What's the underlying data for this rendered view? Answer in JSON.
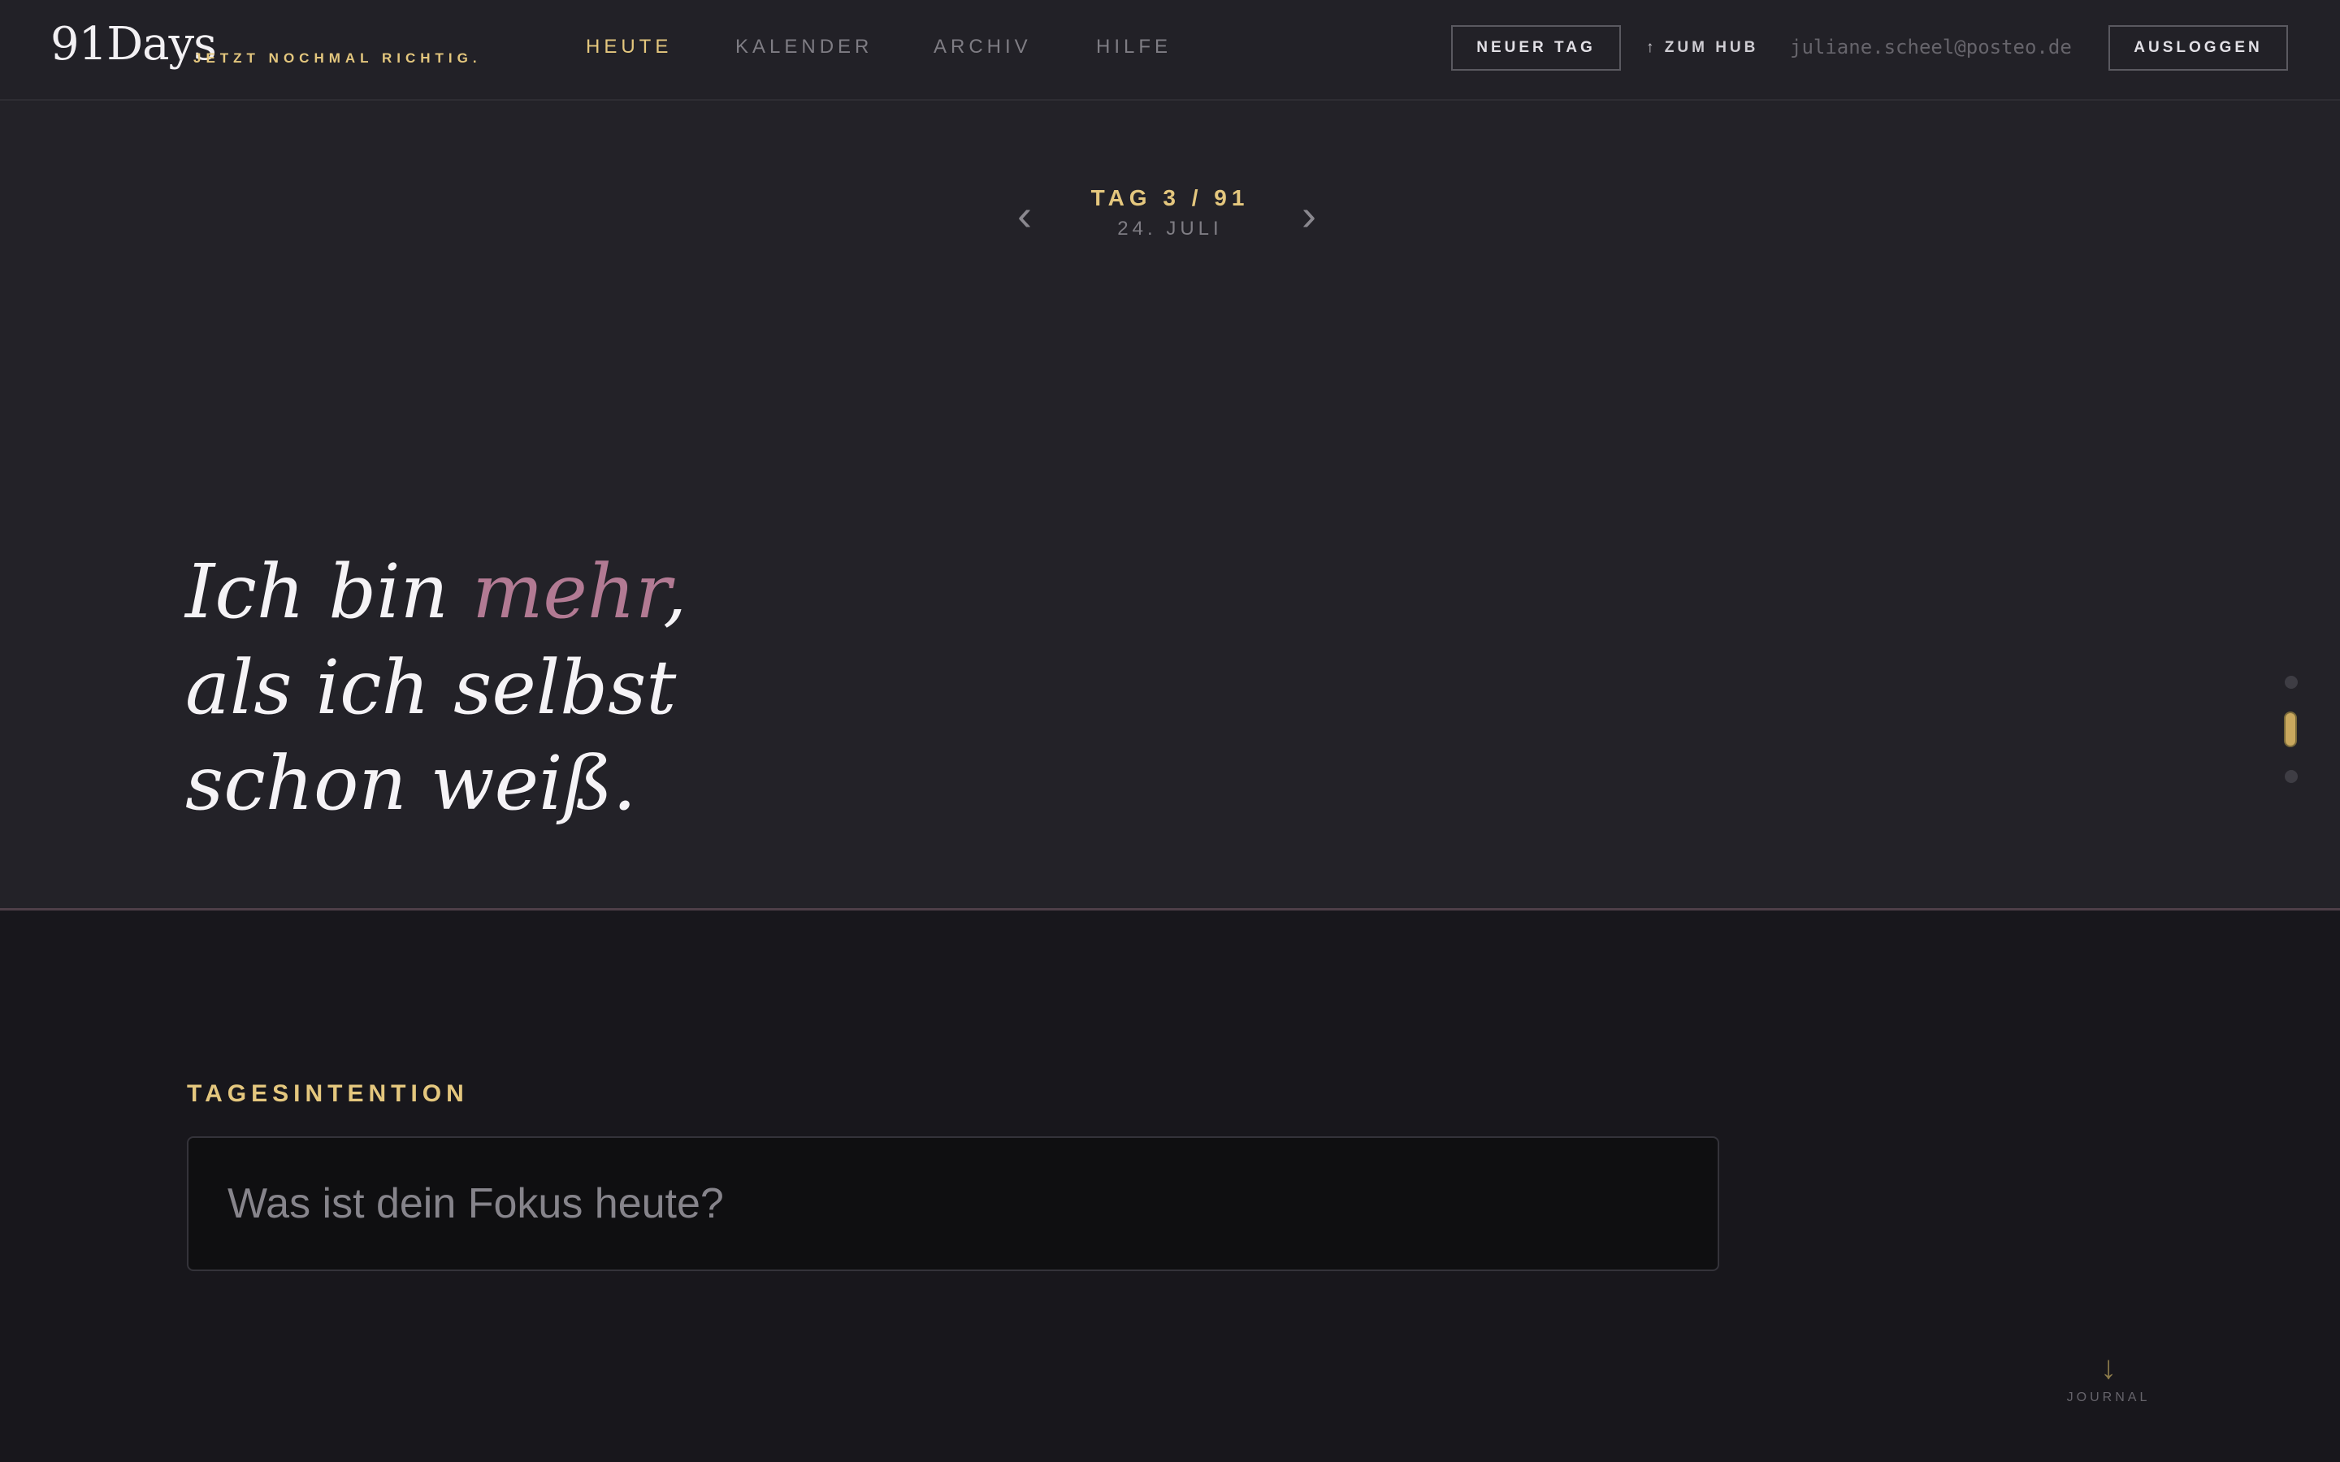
{
  "brand": {
    "logo": "91Days",
    "tagline": "JETZT NOCHMAL RICHTIG."
  },
  "nav": {
    "items": [
      {
        "label": "HEUTE",
        "active": true
      },
      {
        "label": "KALENDER",
        "active": false
      },
      {
        "label": "ARCHIV",
        "active": false
      },
      {
        "label": "HILFE",
        "active": false
      }
    ]
  },
  "header_actions": {
    "new_day": "NEUER TAG",
    "hub": "↑ ZUM HUB",
    "email": "juliane.scheel@posteo.de",
    "logout": "AUSLOGGEN"
  },
  "day_nav": {
    "prev_icon": "chevron-left-icon",
    "next_icon": "chevron-right-icon",
    "prev_glyph": "‹",
    "next_glyph": "›",
    "title": "TAG 3 / 91",
    "date": "24. JULI"
  },
  "quote": {
    "line1_before": "Ich bin ",
    "line1_accent": "mehr",
    "line1_after": ",",
    "line2": "als ich selbst",
    "line3": "schon weiß."
  },
  "slide_dots": {
    "count": 3,
    "active_index": 1
  },
  "intention": {
    "label": "TAGESINTENTION",
    "value": "",
    "placeholder": "Was ist dein Fokus heute?"
  },
  "journal": {
    "icon": "arrow-down-icon",
    "glyph": "↓",
    "label": "JOURNAL"
  },
  "colors": {
    "accent_gold": "#e4c77e",
    "accent_rose": "#b27a93",
    "background": "#18171c",
    "hero_background": "#232228"
  }
}
